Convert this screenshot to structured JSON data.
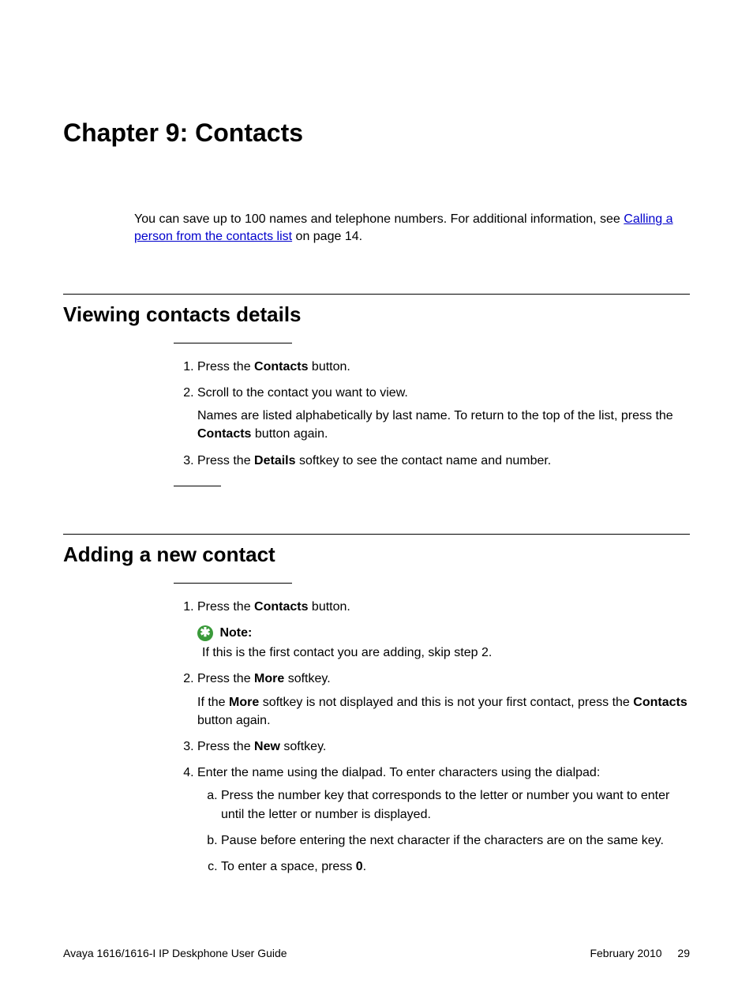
{
  "chapter_title": "Chapter 9:  Contacts",
  "intro": {
    "lead": "You can save up to 100 names and telephone numbers. For additional information, see ",
    "link_text": "Calling a person from the contacts list",
    "trail": " on page 14."
  },
  "section1": {
    "title": "Viewing contacts details",
    "step1_pre": "Press the ",
    "step1_bold": "Contacts",
    "step1_post": " button.",
    "step2_line1": "Scroll to the contact you want to view.",
    "step2_line2_pre": "Names are listed alphabetically by last name. To return to the top of the list, press the ",
    "step2_line2_bold": "Contacts",
    "step2_line2_post": " button again.",
    "step3_pre": "Press the ",
    "step3_bold": "Details",
    "step3_post": " softkey to see the contact name and number."
  },
  "section2": {
    "title": "Adding a new contact",
    "step1_pre": "Press the ",
    "step1_bold": "Contacts",
    "step1_post": " button.",
    "note_label": "Note:",
    "note_text": "If this is the first contact you are adding, skip step 2.",
    "step2_line1_pre": "Press the ",
    "step2_line1_bold": "More",
    "step2_line1_post": " softkey.",
    "step2_line2_pre": "If the ",
    "step2_line2_bold1": "More",
    "step2_line2_mid": " softkey is not displayed and this is not your first contact, press the ",
    "step2_line2_bold2": "Contacts",
    "step2_line2_post": " button again.",
    "step3_pre": "Press the ",
    "step3_bold": "New",
    "step3_post": " softkey.",
    "step4_lead": "Enter the name using the dialpad. To enter characters using the dialpad:",
    "step4a": "Press the number key that corresponds to the letter or number you want to enter until the letter or number is displayed.",
    "step4b": "Pause before entering the next character if the characters are on the same key.",
    "step4c_pre": "To enter a space, press ",
    "step4c_bold": "0",
    "step4c_post": "."
  },
  "footer": {
    "left": "Avaya 1616/1616-I IP Deskphone User Guide",
    "date": "February 2010",
    "page": "29"
  }
}
